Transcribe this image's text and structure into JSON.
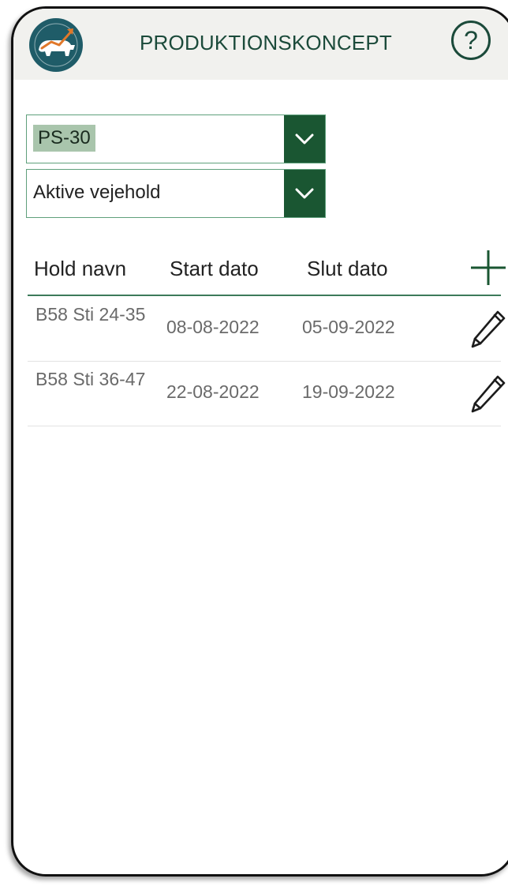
{
  "header": {
    "title": "PRODUKTIONSKONCEPT",
    "help_label": "?"
  },
  "filters": {
    "concept": {
      "value": "PS-30"
    },
    "status": {
      "value": "Aktive vejehold"
    }
  },
  "table": {
    "columns": [
      "Hold navn",
      "Start dato",
      "Slut dato"
    ],
    "rows": [
      {
        "name": "B58 Sti 24-35",
        "start": "08-08-2022",
        "end": "05-09-2022"
      },
      {
        "name": "B58 Sti 36-47",
        "start": "22-08-2022",
        "end": "19-09-2022"
      }
    ]
  },
  "colors": {
    "brand_green": "#1a5632",
    "header_bg": "#f1f1ee",
    "logo_teal": "#1f5c68",
    "logo_accent": "#e0782a"
  },
  "icons": {
    "logo": "pig-logo-icon",
    "help": "question-icon",
    "dropdown": "chevron-down-icon",
    "add": "plus-icon",
    "edit": "pencil-icon"
  }
}
